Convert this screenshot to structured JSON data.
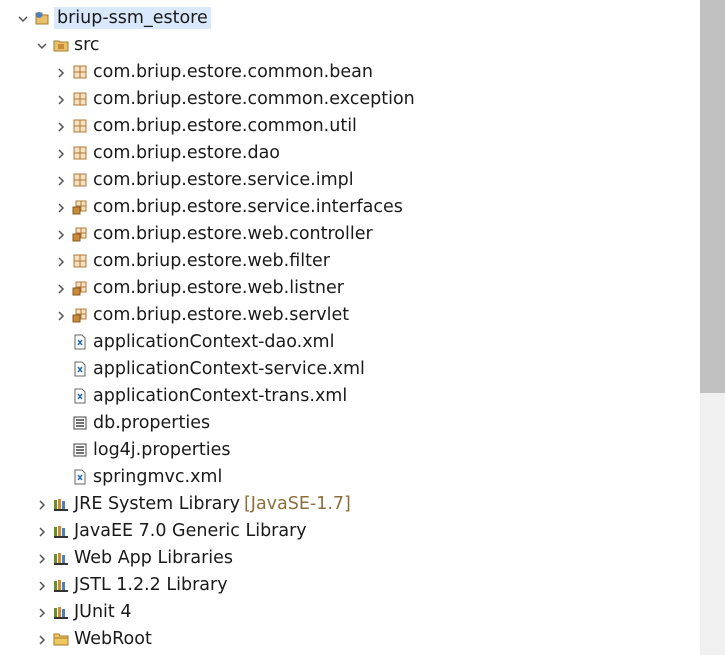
{
  "project": {
    "name": "briup-ssm_estore",
    "children": {
      "src": {
        "label": "src",
        "packages": [
          {
            "label": "com.briup.estore.common.bean",
            "icon": "package-icon"
          },
          {
            "label": "com.briup.estore.common.exception",
            "icon": "package-icon"
          },
          {
            "label": "com.briup.estore.common.util",
            "icon": "package-icon"
          },
          {
            "label": "com.briup.estore.dao",
            "icon": "package-icon"
          },
          {
            "label": "com.briup.estore.service.impl",
            "icon": "package-icon"
          },
          {
            "label": "com.briup.estore.service.interfaces",
            "icon": "package-java-icon"
          },
          {
            "label": "com.briup.estore.web.controller",
            "icon": "package-java-icon"
          },
          {
            "label": "com.briup.estore.web.filter",
            "icon": "package-icon"
          },
          {
            "label": "com.briup.estore.web.listner",
            "icon": "package-java-icon"
          },
          {
            "label": "com.briup.estore.web.servlet",
            "icon": "package-java-icon"
          }
        ],
        "files": [
          {
            "label": "applicationContext-dao.xml",
            "icon": "xml-file-icon"
          },
          {
            "label": "applicationContext-service.xml",
            "icon": "xml-file-icon"
          },
          {
            "label": "applicationContext-trans.xml",
            "icon": "xml-file-icon"
          },
          {
            "label": "db.properties",
            "icon": "properties-file-icon"
          },
          {
            "label": "log4j.properties",
            "icon": "properties-file-icon"
          },
          {
            "label": "springmvc.xml",
            "icon": "xml-file-icon"
          }
        ]
      },
      "libraries": [
        {
          "label": "JRE System Library",
          "decoration": "[JavaSE-1.7]",
          "icon": "library-icon"
        },
        {
          "label": "JavaEE 7.0 Generic Library",
          "decoration": "",
          "icon": "library-icon"
        },
        {
          "label": "Web App Libraries",
          "decoration": "",
          "icon": "library-icon"
        },
        {
          "label": "JSTL 1.2.2 Library",
          "decoration": "",
          "icon": "library-icon"
        },
        {
          "label": "JUnit 4",
          "decoration": "",
          "icon": "library-icon"
        }
      ],
      "folders": [
        {
          "label": "WebRoot",
          "icon": "folder-icon"
        }
      ]
    }
  },
  "colors": {
    "selection": "#d9e8fb",
    "package": "#c98a3a",
    "decoration": "#8b6f3a",
    "scrollbar_track": "#f0f0f0",
    "scrollbar_thumb": "#c1c1c1"
  }
}
